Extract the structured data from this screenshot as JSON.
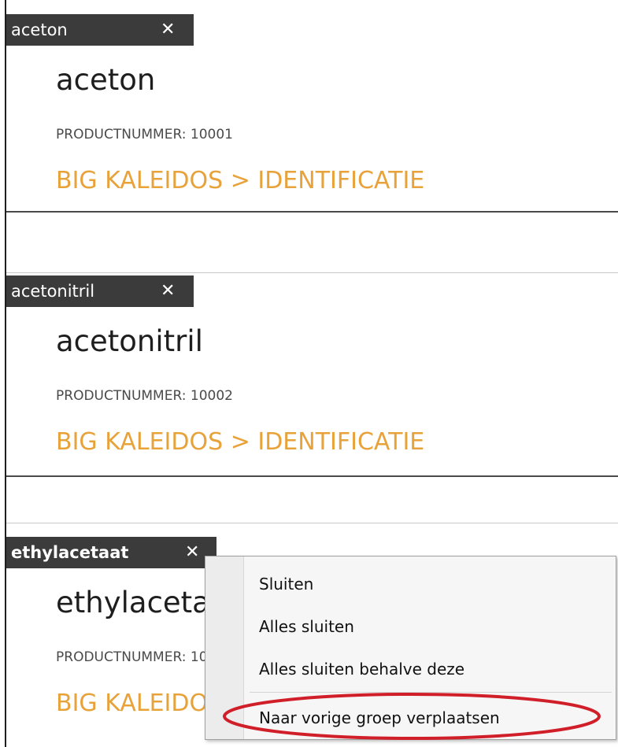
{
  "panels": [
    {
      "tab_title": "aceton",
      "tab_close": "✕",
      "product_name": "aceton",
      "product_number": "PRODUCTNUMMER: 10001",
      "breadcrumb": "BIG KALEIDOS > IDENTIFICATIE"
    },
    {
      "tab_title": "acetonitril",
      "tab_close": "✕",
      "product_name": "acetonitril",
      "product_number": "PRODUCTNUMMER: 10002",
      "breadcrumb": "BIG KALEIDOS > IDENTIFICATIE"
    },
    {
      "tab_title": "ethylacetaat",
      "tab_close": "✕",
      "product_name": "ethylacetaat",
      "product_number": "PRODUCTNUMMER: 10003",
      "breadcrumb": "BIG KALEIDOS > IDENTIFICATIE"
    }
  ],
  "context_menu": {
    "items": [
      "Sluiten",
      "Alles sluiten",
      "Alles sluiten behalve deze",
      "Naar vorige groep verplaatsen"
    ]
  },
  "colors": {
    "tab_background": "#3b3b3b",
    "breadcrumb": "#e8a23a",
    "annotation": "#d11f2a"
  },
  "icons": {
    "tab_close": "close-icon"
  }
}
